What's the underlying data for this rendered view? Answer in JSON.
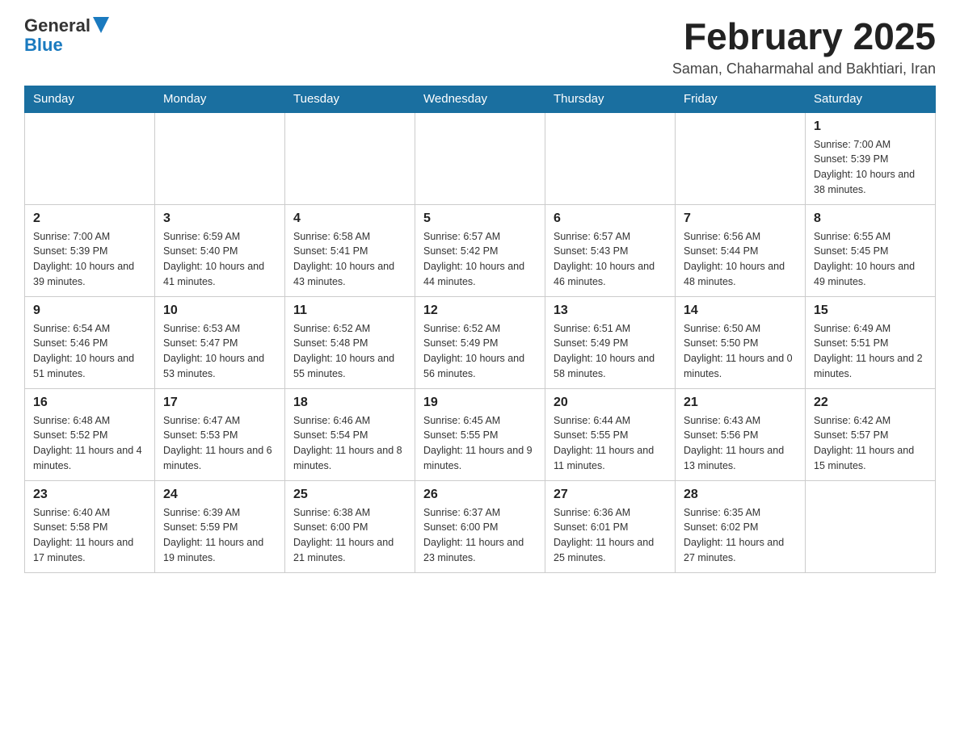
{
  "logo": {
    "general": "General",
    "blue": "Blue"
  },
  "header": {
    "month_title": "February 2025",
    "subtitle": "Saman, Chaharmahal and Bakhtiari, Iran"
  },
  "days_of_week": [
    "Sunday",
    "Monday",
    "Tuesday",
    "Wednesday",
    "Thursday",
    "Friday",
    "Saturday"
  ],
  "weeks": [
    [
      {
        "day": "",
        "info": ""
      },
      {
        "day": "",
        "info": ""
      },
      {
        "day": "",
        "info": ""
      },
      {
        "day": "",
        "info": ""
      },
      {
        "day": "",
        "info": ""
      },
      {
        "day": "",
        "info": ""
      },
      {
        "day": "1",
        "info": "Sunrise: 7:00 AM\nSunset: 5:39 PM\nDaylight: 10 hours and 38 minutes."
      }
    ],
    [
      {
        "day": "2",
        "info": "Sunrise: 7:00 AM\nSunset: 5:39 PM\nDaylight: 10 hours and 39 minutes."
      },
      {
        "day": "3",
        "info": "Sunrise: 6:59 AM\nSunset: 5:40 PM\nDaylight: 10 hours and 41 minutes."
      },
      {
        "day": "4",
        "info": "Sunrise: 6:58 AM\nSunset: 5:41 PM\nDaylight: 10 hours and 43 minutes."
      },
      {
        "day": "5",
        "info": "Sunrise: 6:57 AM\nSunset: 5:42 PM\nDaylight: 10 hours and 44 minutes."
      },
      {
        "day": "6",
        "info": "Sunrise: 6:57 AM\nSunset: 5:43 PM\nDaylight: 10 hours and 46 minutes."
      },
      {
        "day": "7",
        "info": "Sunrise: 6:56 AM\nSunset: 5:44 PM\nDaylight: 10 hours and 48 minutes."
      },
      {
        "day": "8",
        "info": "Sunrise: 6:55 AM\nSunset: 5:45 PM\nDaylight: 10 hours and 49 minutes."
      }
    ],
    [
      {
        "day": "9",
        "info": "Sunrise: 6:54 AM\nSunset: 5:46 PM\nDaylight: 10 hours and 51 minutes."
      },
      {
        "day": "10",
        "info": "Sunrise: 6:53 AM\nSunset: 5:47 PM\nDaylight: 10 hours and 53 minutes."
      },
      {
        "day": "11",
        "info": "Sunrise: 6:52 AM\nSunset: 5:48 PM\nDaylight: 10 hours and 55 minutes."
      },
      {
        "day": "12",
        "info": "Sunrise: 6:52 AM\nSunset: 5:49 PM\nDaylight: 10 hours and 56 minutes."
      },
      {
        "day": "13",
        "info": "Sunrise: 6:51 AM\nSunset: 5:49 PM\nDaylight: 10 hours and 58 minutes."
      },
      {
        "day": "14",
        "info": "Sunrise: 6:50 AM\nSunset: 5:50 PM\nDaylight: 11 hours and 0 minutes."
      },
      {
        "day": "15",
        "info": "Sunrise: 6:49 AM\nSunset: 5:51 PM\nDaylight: 11 hours and 2 minutes."
      }
    ],
    [
      {
        "day": "16",
        "info": "Sunrise: 6:48 AM\nSunset: 5:52 PM\nDaylight: 11 hours and 4 minutes."
      },
      {
        "day": "17",
        "info": "Sunrise: 6:47 AM\nSunset: 5:53 PM\nDaylight: 11 hours and 6 minutes."
      },
      {
        "day": "18",
        "info": "Sunrise: 6:46 AM\nSunset: 5:54 PM\nDaylight: 11 hours and 8 minutes."
      },
      {
        "day": "19",
        "info": "Sunrise: 6:45 AM\nSunset: 5:55 PM\nDaylight: 11 hours and 9 minutes."
      },
      {
        "day": "20",
        "info": "Sunrise: 6:44 AM\nSunset: 5:55 PM\nDaylight: 11 hours and 11 minutes."
      },
      {
        "day": "21",
        "info": "Sunrise: 6:43 AM\nSunset: 5:56 PM\nDaylight: 11 hours and 13 minutes."
      },
      {
        "day": "22",
        "info": "Sunrise: 6:42 AM\nSunset: 5:57 PM\nDaylight: 11 hours and 15 minutes."
      }
    ],
    [
      {
        "day": "23",
        "info": "Sunrise: 6:40 AM\nSunset: 5:58 PM\nDaylight: 11 hours and 17 minutes."
      },
      {
        "day": "24",
        "info": "Sunrise: 6:39 AM\nSunset: 5:59 PM\nDaylight: 11 hours and 19 minutes."
      },
      {
        "day": "25",
        "info": "Sunrise: 6:38 AM\nSunset: 6:00 PM\nDaylight: 11 hours and 21 minutes."
      },
      {
        "day": "26",
        "info": "Sunrise: 6:37 AM\nSunset: 6:00 PM\nDaylight: 11 hours and 23 minutes."
      },
      {
        "day": "27",
        "info": "Sunrise: 6:36 AM\nSunset: 6:01 PM\nDaylight: 11 hours and 25 minutes."
      },
      {
        "day": "28",
        "info": "Sunrise: 6:35 AM\nSunset: 6:02 PM\nDaylight: 11 hours and 27 minutes."
      },
      {
        "day": "",
        "info": ""
      }
    ]
  ]
}
